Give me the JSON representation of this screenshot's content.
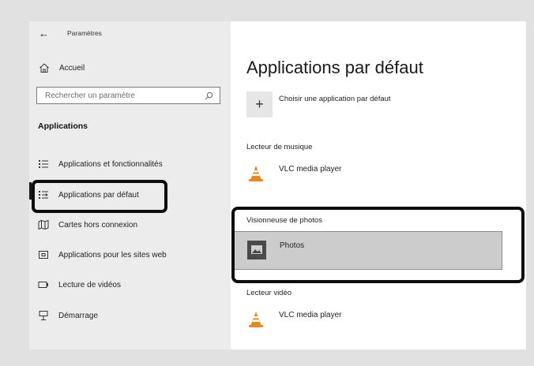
{
  "window": {
    "title": "Paramètres"
  },
  "sidebar": {
    "home_label": "Accueil",
    "search_placeholder": "Rechercher un paramètre",
    "section_heading": "Applications",
    "items": [
      {
        "label": "Applications et fonctionnalités",
        "icon": "list-icon"
      },
      {
        "label": "Applications par défaut",
        "icon": "default-apps-icon",
        "selected": true
      },
      {
        "label": "Cartes hors connexion",
        "icon": "map-icon"
      },
      {
        "label": "Applications pour les sites web",
        "icon": "website-apps-icon"
      },
      {
        "label": "Lecture de vidéos",
        "icon": "video-icon"
      },
      {
        "label": "Démarrage",
        "icon": "startup-icon"
      }
    ]
  },
  "main": {
    "title": "Applications par défaut",
    "choose_default_label": "Choisir une application par défaut",
    "groups": [
      {
        "label": "Lecteur de musique",
        "app": "VLC media player",
        "icon": "vlc-cone-icon"
      },
      {
        "label": "Visionneuse de photos",
        "app": "Photos",
        "icon": "photos-icon",
        "highlighted": true
      },
      {
        "label": "Lecteur vidéo",
        "app": "VLC media player",
        "icon": "vlc-cone-icon"
      }
    ]
  },
  "colors": {
    "background": "#e1e1e1",
    "sidebar": "#ececec",
    "selected_tile": "#cccccc",
    "annotation_outline": "#0d0d0d"
  }
}
